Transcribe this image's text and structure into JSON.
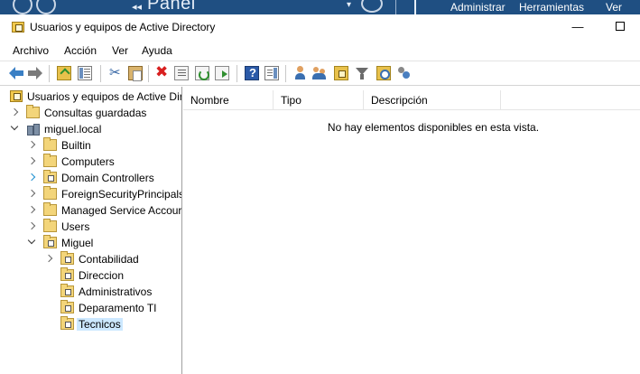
{
  "background_app": {
    "panel_text": "Panel",
    "menu": [
      "Administrar",
      "Herramientas",
      "Ver"
    ]
  },
  "window": {
    "title": "Usuarios y equipos de Active Directory",
    "minimize_glyph": "—"
  },
  "menubar": {
    "items": [
      "Archivo",
      "Acción",
      "Ver",
      "Ayuda"
    ]
  },
  "toolbar": {
    "icons": [
      "back-arrow",
      "forward-arrow",
      "up-one-level",
      "show-hide-console-tree",
      "cut",
      "paste",
      "delete",
      "properties",
      "refresh",
      "export-list",
      "help",
      "show-hide-action-pane",
      "create-user",
      "create-group",
      "create-ou",
      "filter",
      "find",
      "delegate-control"
    ]
  },
  "tree": {
    "root": "Usuarios y equipos de Active Dir",
    "items": [
      {
        "label": "Consultas guardadas",
        "level": 1,
        "expander": "collapsed",
        "icon": "folder"
      },
      {
        "label": "miguel.local",
        "level": 1,
        "expander": "expanded",
        "icon": "domain"
      },
      {
        "label": "Builtin",
        "level": 2,
        "expander": "collapsed",
        "icon": "folder"
      },
      {
        "label": "Computers",
        "level": 2,
        "expander": "collapsed",
        "icon": "folder"
      },
      {
        "label": "Domain Controllers",
        "level": 2,
        "expander": "collapsed-highlight",
        "icon": "ou"
      },
      {
        "label": "ForeignSecurityPrincipals",
        "level": 2,
        "expander": "collapsed",
        "icon": "folder"
      },
      {
        "label": "Managed Service Accour",
        "level": 2,
        "expander": "collapsed",
        "icon": "folder"
      },
      {
        "label": "Users",
        "level": 2,
        "expander": "collapsed",
        "icon": "folder"
      },
      {
        "label": "Miguel",
        "level": 2,
        "expander": "expanded",
        "icon": "ou"
      },
      {
        "label": "Contabilidad",
        "level": 3,
        "expander": "collapsed",
        "icon": "ou"
      },
      {
        "label": "Direccion",
        "level": 3,
        "expander": "none",
        "icon": "ou"
      },
      {
        "label": "Administrativos",
        "level": 3,
        "expander": "none",
        "icon": "ou"
      },
      {
        "label": "Deparamento TI",
        "level": 3,
        "expander": "none",
        "icon": "ou"
      },
      {
        "label": "Tecnicos",
        "level": 3,
        "expander": "none",
        "icon": "ou",
        "selected": true
      }
    ]
  },
  "list": {
    "columns": [
      "Nombre",
      "Tipo",
      "Descripción"
    ],
    "empty_message": "No hay elementos disponibles en esta vista."
  },
  "colors": {
    "background_app_bar": "#1f4f82",
    "selection": "#cce8ff",
    "folder": "#f3d57a"
  }
}
